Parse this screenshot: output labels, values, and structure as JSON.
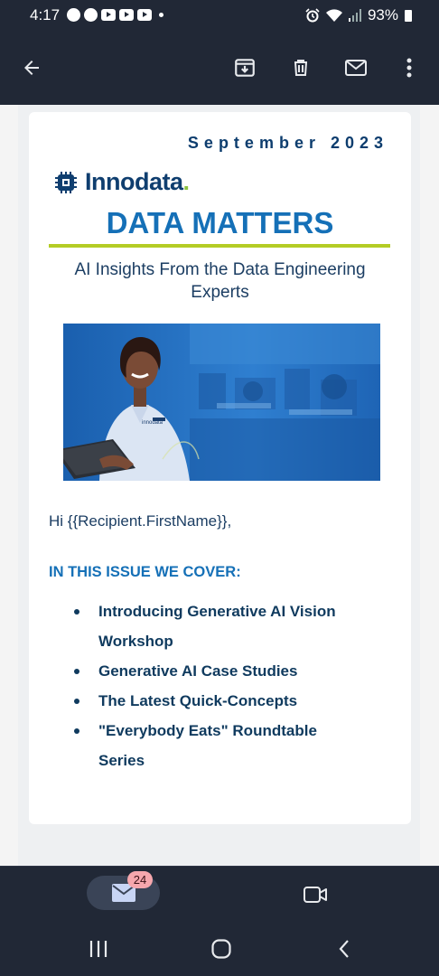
{
  "status_bar": {
    "time": "4:17",
    "battery": "93%",
    "notification_icons": [
      "whatsapp-icon",
      "messenger-icon",
      "youtube-icon",
      "youtube-icon",
      "youtube-icon",
      "more-dot-icon"
    ],
    "system_icons": [
      "alarm-icon",
      "wifi-icon",
      "signal-icon",
      "battery-icon"
    ]
  },
  "app_bar": {
    "actions": [
      "back-icon",
      "archive-icon",
      "delete-icon",
      "mark-unread-icon",
      "more-vert-icon"
    ]
  },
  "email": {
    "issue_date": "September 2023",
    "logo_text": "Innodata",
    "logo_dot": ".",
    "title": "DATA MATTERS",
    "subtitle": "AI Insights From the Data Engineering Experts",
    "hero_image_label": "innodata",
    "greeting": "Hi {{Recipient.FirstName}},",
    "section_heading": "IN THIS ISSUE WE COVER:",
    "items": [
      "Introducing Generative AI Vision Workshop",
      "Generative AI Case Studies",
      "The Latest Quick-Concepts",
      "\"Everybody Eats\" Roundtable Series"
    ]
  },
  "bottom_nav": {
    "mail_badge": "24",
    "tabs": [
      "mail-icon",
      "meet-icon"
    ]
  },
  "system_nav": [
    "recents-icon",
    "home-icon",
    "back-icon"
  ],
  "colors": {
    "bar_background": "#212836",
    "brand_blue": "#1570b7",
    "brand_navy": "#0f3e6f",
    "accent_green": "#b4cc25",
    "badge": "#f6a7ad"
  }
}
